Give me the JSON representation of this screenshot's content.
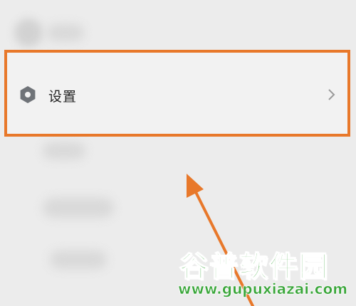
{
  "settings_item": {
    "label": "设置",
    "icon": "settings-icon",
    "chevron_icon": "chevron-right-icon"
  },
  "highlight": {
    "color": "#e8782a"
  },
  "watermark": {
    "title": "谷普软件园",
    "url": "www.gupuxiazai.com",
    "color": "#3aa63a"
  }
}
